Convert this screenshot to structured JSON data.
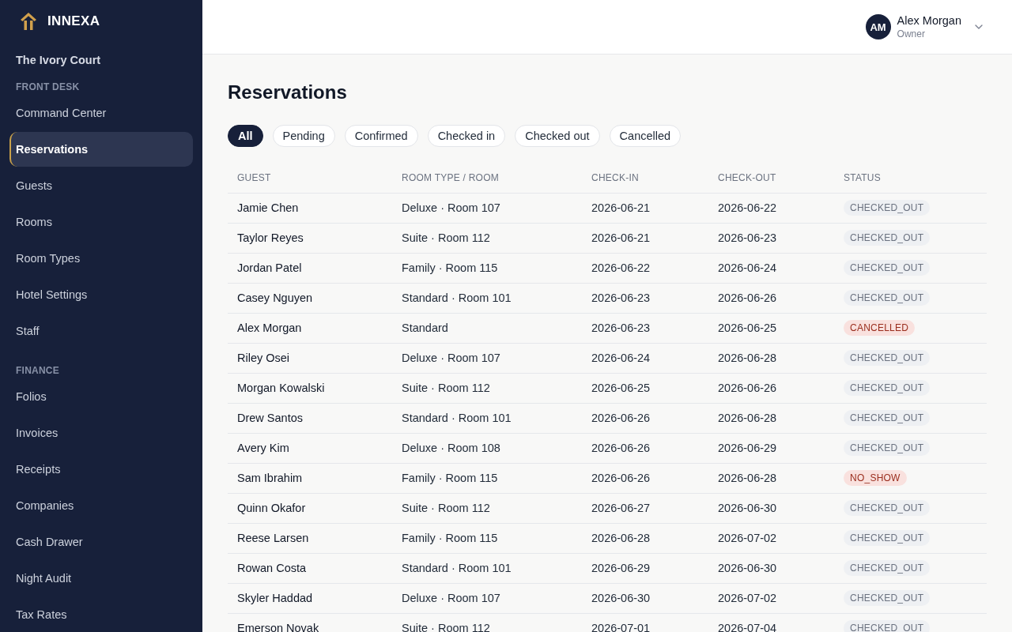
{
  "sidebar": {
    "brand": "INNEXA",
    "property": "The Ivory Court",
    "sections": [
      {
        "heading": "FRONT DESK",
        "items": [
          {
            "label": "Command Center",
            "selected": false
          },
          {
            "label": "Reservations",
            "selected": true
          },
          {
            "label": "Guests",
            "selected": false
          },
          {
            "label": "Rooms",
            "selected": false
          },
          {
            "label": "Room Types",
            "selected": false
          },
          {
            "label": "Hotel Settings",
            "selected": false
          },
          {
            "label": "Staff",
            "selected": false
          }
        ]
      },
      {
        "heading": "FINANCE",
        "items": [
          {
            "label": "Folios",
            "selected": false
          },
          {
            "label": "Invoices",
            "selected": false
          },
          {
            "label": "Receipts",
            "selected": false
          },
          {
            "label": "Companies",
            "selected": false
          },
          {
            "label": "Cash Drawer",
            "selected": false
          },
          {
            "label": "Night Audit",
            "selected": false
          },
          {
            "label": "Tax Rates",
            "selected": false
          }
        ]
      }
    ]
  },
  "header": {
    "user": {
      "initials": "AM",
      "name": "Alex Morgan",
      "role": "Owner"
    }
  },
  "page": {
    "title": "Reservations"
  },
  "filters": [
    {
      "label": "All",
      "selected": true
    },
    {
      "label": "Pending",
      "selected": false
    },
    {
      "label": "Confirmed",
      "selected": false
    },
    {
      "label": "Checked in",
      "selected": false
    },
    {
      "label": "Checked out",
      "selected": false
    },
    {
      "label": "Cancelled",
      "selected": false
    }
  ],
  "table": {
    "columns": [
      "GUEST",
      "ROOM TYPE / ROOM",
      "CHECK-IN",
      "CHECK-OUT",
      "STATUS"
    ],
    "rows": [
      {
        "guest": "Jamie Chen",
        "room": "Deluxe · Room 107",
        "check_in": "2026-06-21",
        "check_out": "2026-06-22",
        "status": {
          "label": "CHECKED_OUT",
          "kind": "neutral"
        }
      },
      {
        "guest": "Taylor Reyes",
        "room": "Suite · Room 112",
        "check_in": "2026-06-21",
        "check_out": "2026-06-23",
        "status": {
          "label": "CHECKED_OUT",
          "kind": "neutral"
        }
      },
      {
        "guest": "Jordan Patel",
        "room": "Family · Room 115",
        "check_in": "2026-06-22",
        "check_out": "2026-06-24",
        "status": {
          "label": "CHECKED_OUT",
          "kind": "neutral"
        }
      },
      {
        "guest": "Casey Nguyen",
        "room": "Standard · Room 101",
        "check_in": "2026-06-23",
        "check_out": "2026-06-26",
        "status": {
          "label": "CHECKED_OUT",
          "kind": "neutral"
        }
      },
      {
        "guest": "Alex Morgan",
        "room": "Standard",
        "check_in": "2026-06-23",
        "check_out": "2026-06-25",
        "status": {
          "label": "CANCELLED",
          "kind": "danger"
        }
      },
      {
        "guest": "Riley Osei",
        "room": "Deluxe · Room 107",
        "check_in": "2026-06-24",
        "check_out": "2026-06-28",
        "status": {
          "label": "CHECKED_OUT",
          "kind": "neutral"
        }
      },
      {
        "guest": "Morgan Kowalski",
        "room": "Suite · Room 112",
        "check_in": "2026-06-25",
        "check_out": "2026-06-26",
        "status": {
          "label": "CHECKED_OUT",
          "kind": "neutral"
        }
      },
      {
        "guest": "Drew Santos",
        "room": "Standard · Room 101",
        "check_in": "2026-06-26",
        "check_out": "2026-06-28",
        "status": {
          "label": "CHECKED_OUT",
          "kind": "neutral"
        }
      },
      {
        "guest": "Avery Kim",
        "room": "Deluxe · Room 108",
        "check_in": "2026-06-26",
        "check_out": "2026-06-29",
        "status": {
          "label": "CHECKED_OUT",
          "kind": "neutral"
        }
      },
      {
        "guest": "Sam Ibrahim",
        "room": "Family · Room 115",
        "check_in": "2026-06-26",
        "check_out": "2026-06-28",
        "status": {
          "label": "NO_SHOW",
          "kind": "danger"
        }
      },
      {
        "guest": "Quinn Okafor",
        "room": "Suite · Room 112",
        "check_in": "2026-06-27",
        "check_out": "2026-06-30",
        "status": {
          "label": "CHECKED_OUT",
          "kind": "neutral"
        }
      },
      {
        "guest": "Reese Larsen",
        "room": "Family · Room 115",
        "check_in": "2026-06-28",
        "check_out": "2026-07-02",
        "status": {
          "label": "CHECKED_OUT",
          "kind": "neutral"
        }
      },
      {
        "guest": "Rowan Costa",
        "room": "Standard · Room 101",
        "check_in": "2026-06-29",
        "check_out": "2026-06-30",
        "status": {
          "label": "CHECKED_OUT",
          "kind": "neutral"
        }
      },
      {
        "guest": "Skyler Haddad",
        "room": "Deluxe · Room 107",
        "check_in": "2026-06-30",
        "check_out": "2026-07-02",
        "status": {
          "label": "CHECKED_OUT",
          "kind": "neutral"
        }
      },
      {
        "guest": "Emerson Novak",
        "room": "Suite · Room 112",
        "check_in": "2026-07-01",
        "check_out": "2026-07-04",
        "status": {
          "label": "CHECKED_OUT",
          "kind": "neutral"
        }
      }
    ]
  }
}
